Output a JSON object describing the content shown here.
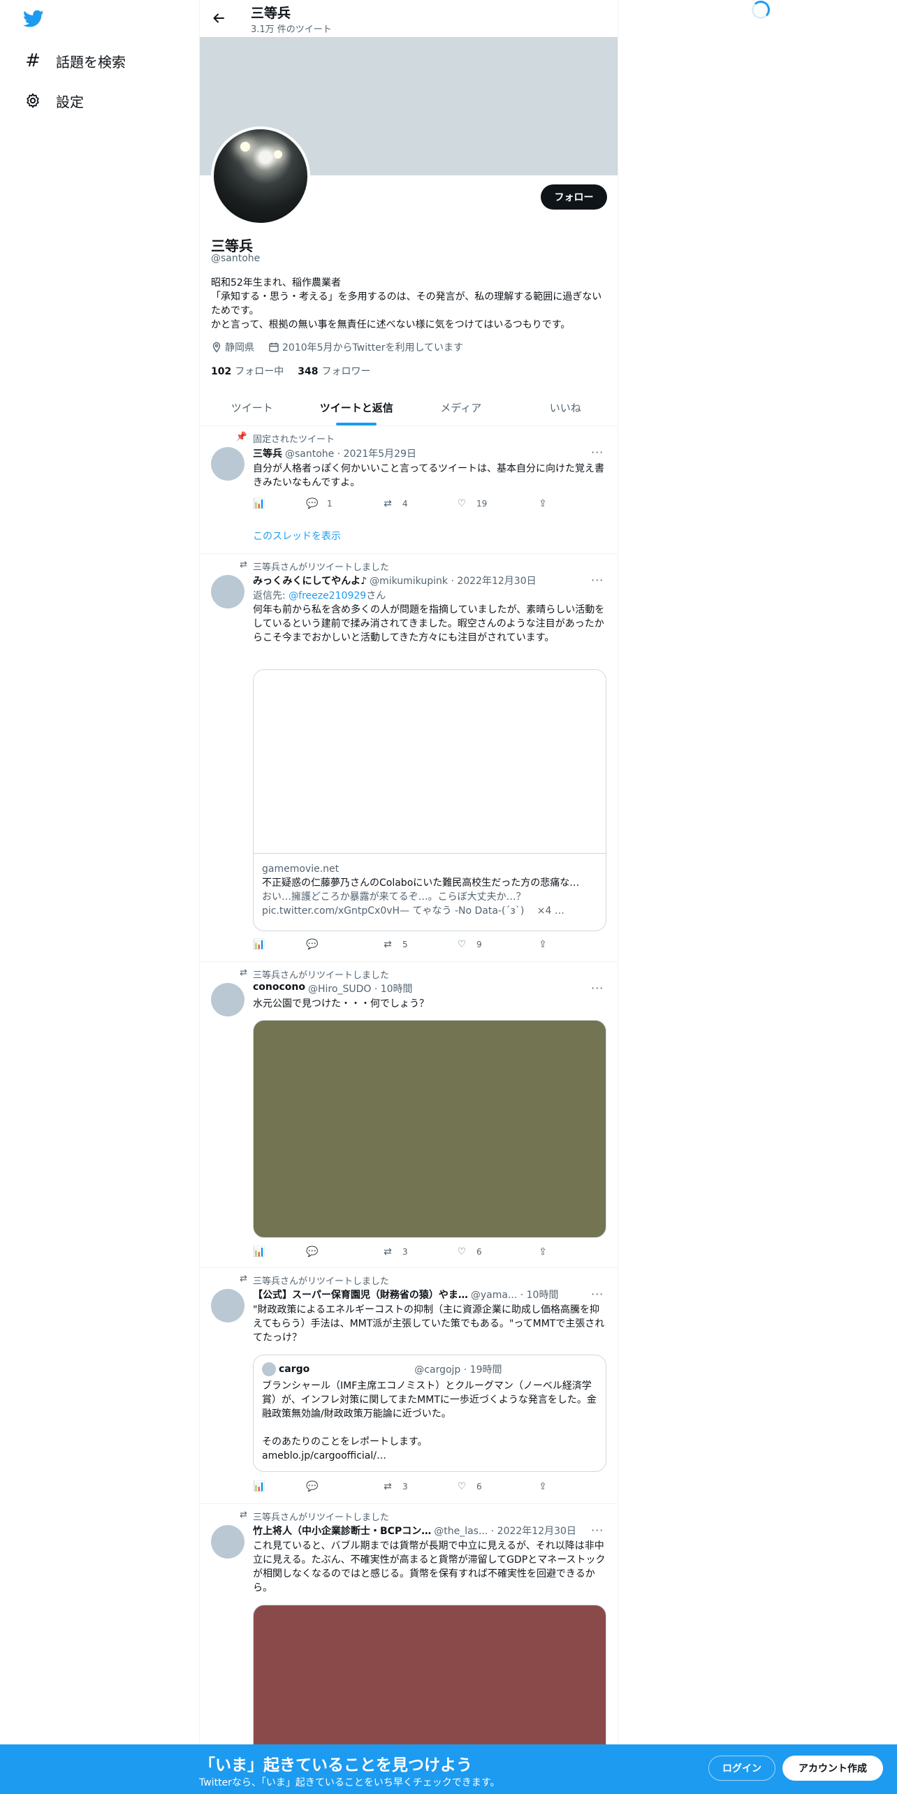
{
  "nav": {
    "explore_label": "話題を検索",
    "settings_label": "設定"
  },
  "header": {
    "title": "三等兵",
    "subtitle": "3.1万 件のツイート"
  },
  "profile": {
    "name": "三等兵",
    "handle": "@santohe",
    "follow_label": "フォロー",
    "bio": "昭和52年生まれ、稲作農業者\n「承知する・思う・考える」を多用するのは、その発言が、私の理解する範囲に過ぎないためです。\nかと言って、根拠の無い事を無責任に述べない様に気をつけてはいるつもりです。",
    "location": "静岡県",
    "joined": "2010年5月からTwitterを利用しています",
    "following_count": "102",
    "following_label": "フォロー中",
    "followers_count": "348",
    "followers_label": "フォロワー"
  },
  "tabs": [
    "ツイート",
    "ツイートと返信",
    "メディア",
    "いいね"
  ],
  "tweets": [
    {
      "context": "固定されたツイート",
      "name": "三等兵",
      "handle_time": "@santohe · 2021年5月29日",
      "text": "自分が人格者っぽく何かいいこと言ってるツイートは、基本自分に向けた覚え書きみたいなもんですよ。",
      "replies": "1",
      "retweets": "4",
      "likes": "19",
      "thread_link": "このスレッドを表示"
    },
    {
      "context": "三等兵さんがリツイートしました",
      "name": "みっくみくにしてやんよ♪",
      "handle_time": "@mikumikupink · 2022年12月30日",
      "reply_prefix": "返信先: ",
      "reply_to": "@freeze210929",
      "reply_suffix": "さん",
      "text": "何年も前から私を含め多くの人が問題を指摘していましたが、素晴らしい活動をしているという建前で揉み消されてきました。暇空さんのような注目があったからこそ今までおかしいと活動してきた方々にも注目がされています。",
      "card_domain": "gamemovie.net",
      "card_title": "不正疑惑の仁藤夢乃さんのColaboにいた難民高校生だった方の悲痛な…",
      "card_desc": "おい…擁護どころか暴露が来てるぞ…。こらぼ大丈夫か…？\npic.twitter.com/xGntpCx0vH— てゃなう -No Data-(´з`)　 ×4 …",
      "replies": "",
      "retweets": "5",
      "likes": "9"
    },
    {
      "context": "三等兵さんがリツイートしました",
      "name": "conocono",
      "handle_time": "@Hiro_SUDO · 10時間",
      "text": "水元公園で見つけた・・・何でしょう？",
      "media_color": "#727452",
      "replies": "",
      "retweets": "3",
      "likes": "6"
    },
    {
      "context": "三等兵さんがリツイートしました",
      "name": "【公式】スーパー保育園児（財務省の猿）やま…",
      "handle_time": "@yama... · 10時間",
      "text": "\"財政政策によるエネルギーコストの抑制（主に資源企業に助成し価格高騰を抑えてもらう）手法は、MMT派が主張していた策でもある。\"ってMMTで主張されてたっけ？",
      "quote_name": "cargo",
      "quote_handle_time": "@cargojp · 19時間",
      "quote_text": "ブランシャール（IMF主席エコノミスト）とクルーグマン（ノーベル経済学賞）が、インフレ対策に関してまたMMTに一歩近づくような発言をした。金融政策無効論/財政政策万能論に近づいた。\n\nそのあたりのことをレポートします。\nameblo.jp/cargoofficial/…",
      "replies": "",
      "retweets": "3",
      "likes": "6"
    },
    {
      "context": "三等兵さんがリツイートしました",
      "name": "竹上将人（中小企業診断士・BCPコン…",
      "handle_time": "@the_las... · 2022年12月30日",
      "text": "これ見ていると、バブル期までは貨幣が長期で中立に見えるが、それ以降は非中立に見える。たぶん、不確実性が高まると貨幣が滞留してGDPとマネーストックが相関しなくなるのではと感じる。貨幣を保有すれば不確実性を回避できるから。",
      "media_color": "#8b4a4a"
    }
  ],
  "bottom_bar": {
    "title": "「いま」起きていることを見つけよう",
    "subtitle": "Twitterなら、「いま」起きていることをいち早くチェックできます。",
    "login_label": "ログイン",
    "signup_label": "アカウント作成"
  },
  "colors": {
    "accent": "#1d9bf0",
    "banner": "#cfd9de"
  }
}
